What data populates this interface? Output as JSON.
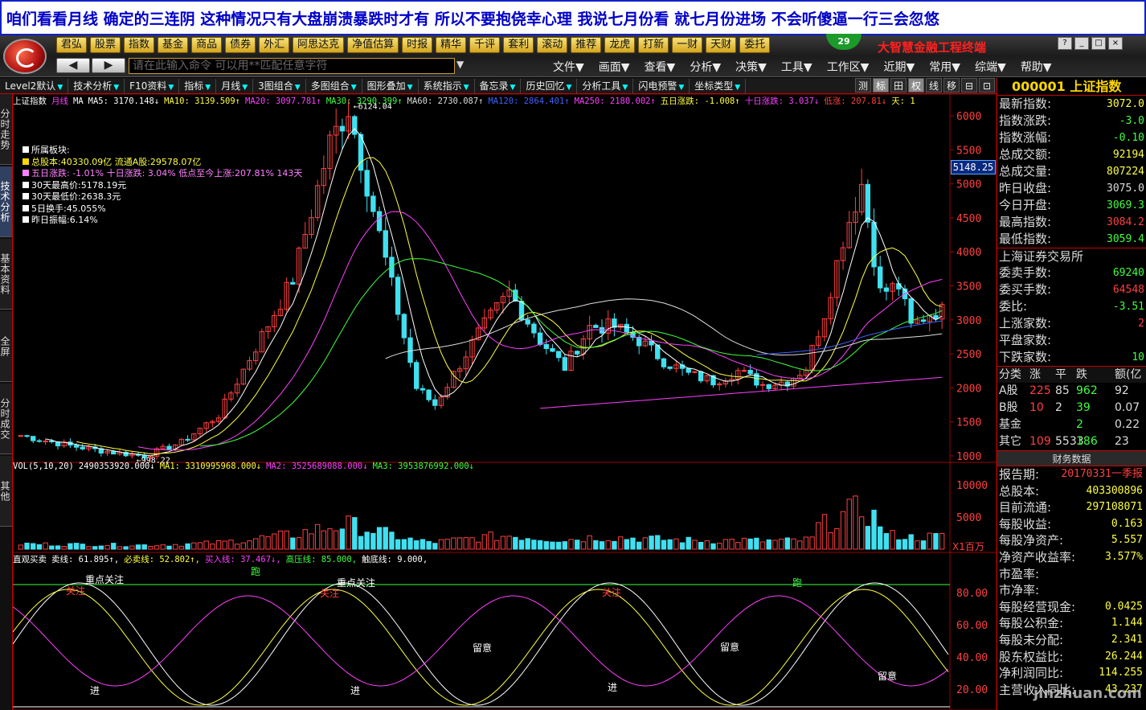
{
  "banner": {
    "text": "咱们看看月线 确定的三连阴 这种情况只有大盘崩溃暴跌时才有 所以不要抱侥幸心理 我说七月份看 就七月份进场 不会听傻逼一行三会忽悠"
  },
  "top_menu": [
    "君弘",
    "股票",
    "指数",
    "基金",
    "商品",
    "债券",
    "外汇",
    "阿思达克",
    "净值估算",
    "时报",
    "精华",
    "千评",
    "套利",
    "滚动",
    "推荐",
    "龙虎",
    "打新",
    "一财",
    "天财",
    "委托"
  ],
  "badge": "29",
  "brand": "大智慧金融工程终端",
  "window_buttons": [
    "?",
    "_",
    "□",
    "×"
  ],
  "nav": {
    "back": "◀",
    "forward": "▶"
  },
  "command": {
    "placeholder": "请在此输入命令  可以用**匹配任意字符"
  },
  "menu2": [
    "文件▼",
    "画面▼",
    "查看▼",
    "分析▼",
    "决策▼",
    "工具▼",
    "工作区▼",
    "近期▼",
    "常用▼",
    "综端▼",
    "帮助▼"
  ],
  "toolbar": [
    "Level2默认",
    "技术分析",
    "F10资料",
    "指标",
    "月线",
    "3图组合",
    "多图组合",
    "图形叠加",
    "系统指示",
    "备忘录",
    "历史回忆",
    "分析工具",
    "闪电预警",
    "坐标类型"
  ],
  "toolbar_right": [
    "测",
    "标",
    "田",
    "权",
    "线",
    "移",
    "⊟",
    "⊡"
  ],
  "left_tabs": [
    "分时走势",
    "技术分析",
    "基本资料",
    "全屏",
    "分时成交",
    "其他"
  ],
  "ma_line": [
    {
      "t": "上证指数",
      "c": "#ffffff"
    },
    {
      "t": "月线",
      "c": "#ff40ff"
    },
    {
      "t": "MA",
      "c": "#ffffff"
    },
    {
      "t": "MA5: 3170.148↓",
      "c": "#ffffff"
    },
    {
      "t": "MA10: 3139.509↑",
      "c": "#ffff40"
    },
    {
      "t": "MA20: 3097.781↑",
      "c": "#ff40ff"
    },
    {
      "t": "MA30: 3290.399↑",
      "c": "#40ff40"
    },
    {
      "t": "MA60: 2730.087↑",
      "c": "#dddddd"
    },
    {
      "t": "MA120: 2864.401↑",
      "c": "#4060ff"
    },
    {
      "t": "MA250: 2180.002↑",
      "c": "#ff40ff"
    },
    {
      "t": "五日涨跌: -1.008↑",
      "c": "#ffff40"
    },
    {
      "t": "十日涨跌: 3.037↓",
      "c": "#ff40ff"
    },
    {
      "t": "低涨: 207.81↓",
      "c": "#ff4040"
    },
    {
      "t": "天: 1",
      "c": "#ffff40"
    }
  ],
  "info": [
    {
      "t": "所属板块:",
      "c": "#ffffff"
    },
    {
      "t": "总股本:40330.09亿   流通A股:29578.07亿",
      "c": "#ffff40"
    },
    {
      "t": "五日涨跌: -1.01%    十日涨跌: 3.04%  低点至今上涨:207.81%   143天",
      "c": "#ff80ff"
    },
    {
      "t": "30天最高价:5178.19元",
      "c": "#ffffff"
    },
    {
      "t": "30天最低价:2638.3元",
      "c": "#ffffff"
    },
    {
      "t": "5日换手:45.055%",
      "c": "#ffffff"
    },
    {
      "t": "昨日振幅:6.14%",
      "c": "#ffffff"
    }
  ],
  "price_tag": "5148.25",
  "price_axis": [
    "6000",
    "5500",
    "5000",
    "4500",
    "4000",
    "3500",
    "3000",
    "2500",
    "2000",
    "1500",
    "1000"
  ],
  "peak_label": "6124.04",
  "low_label": "998.22",
  "vol_line": [
    {
      "t": "VOL(5,10,20)",
      "c": "#ffffff"
    },
    {
      "t": "2490353920.000↓",
      "c": "#ffffff"
    },
    {
      "t": "MA1: 3310995968.000↓",
      "c": "#ffff40"
    },
    {
      "t": "MA2: 3525689088.000↓",
      "c": "#ff40ff"
    },
    {
      "t": "MA3: 3953876992.000↓",
      "c": "#40ff40"
    }
  ],
  "vol_axis": [
    "10000",
    "5000"
  ],
  "vol_unit": "X1百万",
  "ind_line": [
    {
      "t": "直观买卖",
      "c": "#ffffff"
    },
    {
      "t": "卖线: 61.895↑,",
      "c": "#ffffff"
    },
    {
      "t": "必卖线: 52.802↑,",
      "c": "#ffff40"
    },
    {
      "t": "买入线: 37.467↓,",
      "c": "#ff40ff"
    },
    {
      "t": "高压线: 85.000,",
      "c": "#40ff40"
    },
    {
      "t": "触底线: 9.000,",
      "c": "#ffffff"
    }
  ],
  "ind_axis": [
    "80.00",
    "60.00",
    "40.00",
    "20.00"
  ],
  "signals": {
    "focus": "重点关注",
    "watch": "关注",
    "note": "留意",
    "enter": "进",
    "sell": "跑"
  },
  "panel": {
    "title": "000001 上证指数",
    "quotes": [
      {
        "l": "最新指数:",
        "v": "3072.0",
        "c": "#ffff40"
      },
      {
        "l": "指数涨跌:",
        "v": "-3.0",
        "c": "#40ff40"
      },
      {
        "l": "指数涨幅:",
        "v": "-0.10",
        "c": "#40ff40"
      },
      {
        "l": "总成交额:",
        "v": "92194",
        "c": "#ffff40"
      },
      {
        "l": "总成交量:",
        "v": "807224",
        "c": "#ffff40"
      },
      {
        "l": "昨日收盘:",
        "v": "3075.0",
        "c": "#dddddd"
      },
      {
        "l": "今日开盘:",
        "v": "3069.3",
        "c": "#40ff40"
      },
      {
        "l": "最高指数:",
        "v": "3084.2",
        "c": "#ff4040"
      },
      {
        "l": "最低指数:",
        "v": "3059.4",
        "c": "#40ff40"
      }
    ],
    "exchange": "上海证券交易所",
    "orders": [
      {
        "l": "委卖手数:",
        "v": "69240",
        "c": "#40ff40"
      },
      {
        "l": "委买手数:",
        "v": "64548",
        "c": "#ff4040"
      },
      {
        "l": "委比:",
        "v": "-3.51",
        "c": "#40ff40"
      },
      {
        "l": "上涨家数:",
        "v": "2",
        "c": "#ff4040"
      },
      {
        "l": "平盘家数:",
        "v": "",
        "c": "#dddddd"
      },
      {
        "l": "下跌家数:",
        "v": "10",
        "c": "#40ff40"
      }
    ],
    "grid_head": [
      "分类",
      "涨",
      "平",
      "跌",
      "额(亿"
    ],
    "grid": [
      [
        "A股",
        "225",
        "85",
        "962",
        "92"
      ],
      [
        "B股",
        "10",
        "2",
        "39",
        "0.07"
      ],
      [
        "基金",
        "",
        "",
        "2",
        "0.22"
      ],
      [
        "其它",
        "109",
        "5533",
        "186",
        "23"
      ]
    ],
    "fin_title": "财务数据",
    "fin": [
      {
        "l": "报告期:",
        "v": "20170331一季报",
        "c": "#ff4040"
      },
      {
        "l": "总股本:",
        "v": "403300896"
      },
      {
        "l": "目前流通:",
        "v": "297108071"
      },
      {
        "l": "每股收益:",
        "v": "0.163"
      },
      {
        "l": "每股净资产:",
        "v": "5.557"
      },
      {
        "l": "净资产收益率:",
        "v": "3.577%"
      },
      {
        "l": "市盈率:",
        "v": ""
      },
      {
        "l": "市净率:",
        "v": ""
      },
      {
        "l": "每股经营现金:",
        "v": "0.0425"
      },
      {
        "l": "每股公积金:",
        "v": "1.144"
      },
      {
        "l": "每股未分配:",
        "v": "2.341"
      },
      {
        "l": "股东权益比:",
        "v": "26.244"
      },
      {
        "l": "净利润同比:",
        "v": "114.255"
      },
      {
        "l": "主营收入同比:",
        "v": "43.237"
      }
    ]
  },
  "watermark": "jinzhuan.com",
  "colors": {
    "up": "#ff4040",
    "down": "#40e0f0",
    "grid": "#800000",
    "accent": "#ffd700"
  }
}
